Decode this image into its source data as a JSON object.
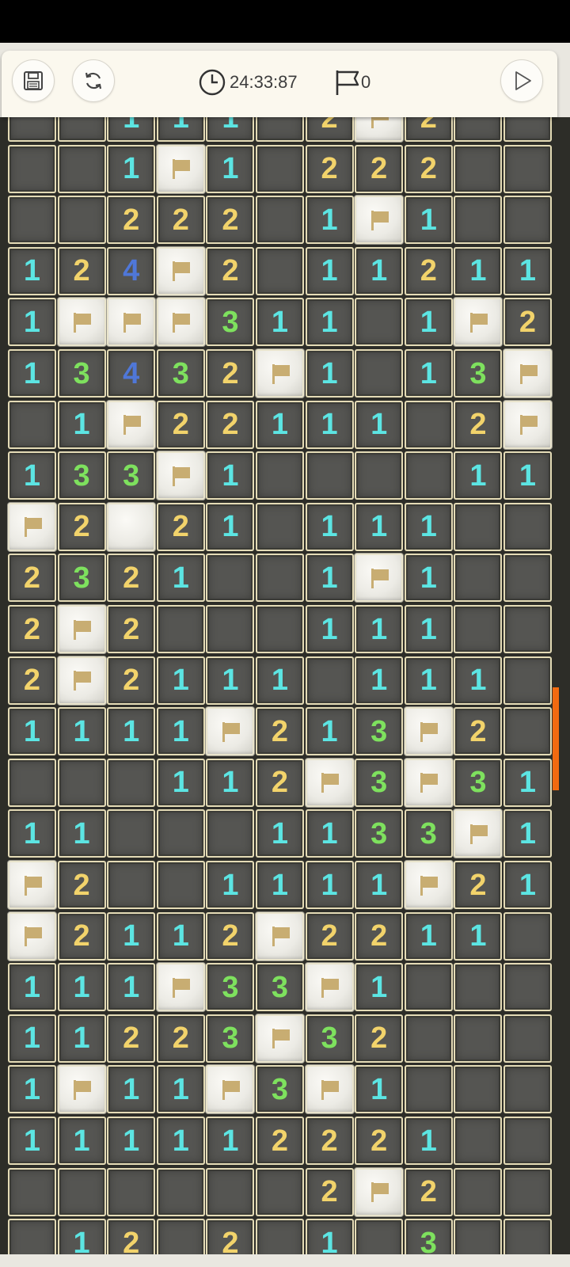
{
  "toolbar": {
    "save_icon": "save-floppy-icon",
    "restart_icon": "restart-refresh-icon",
    "timer_icon": "clock-icon",
    "timer_value": "24:33:87",
    "flag_icon": "flag-outline-icon",
    "flag_count": "0",
    "play_icon": "play-triangle-icon"
  },
  "colors": {
    "1": "#5ce5e3",
    "2": "#f2d36b",
    "3": "#7ee15e",
    "4": "#4f77d8",
    "flag": "#c8ad72",
    "accent": "#f26a10"
  },
  "board": {
    "rows": [
      "..111.2F2..",
      "..1F1.222..",
      "..222.1F1..",
      "124F2.11211",
      "1FFF311.1F2",
      "13432F1.13F",
      ".1F22111.2F",
      "133F1....11",
      "F2T21.111..",
      "2321..1F1..",
      "2F2...111..",
      "2F2111.111.",
      "1111F213F2.",
      "...112F3F31",
      "11...1133F1",
      "F2..1111F21",
      "F2112F2211.",
      "111F33F1...",
      "11223F32...",
      "1F11F3F1...",
      "111112221..",
      "......2F2..",
      ".12.2.1.3.."
    ]
  }
}
